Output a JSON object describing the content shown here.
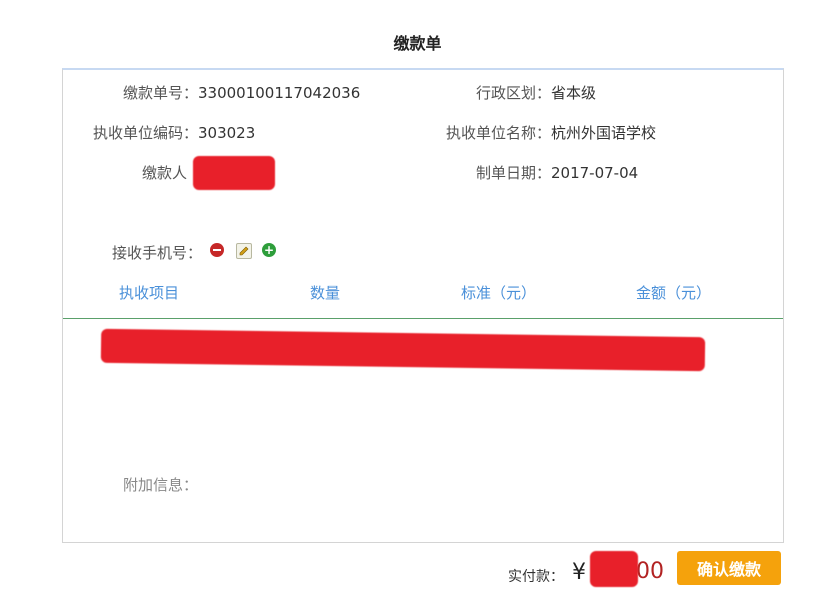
{
  "page_title": "缴款单",
  "fields": {
    "payment_no_label": "缴款单号：",
    "payment_no_value": "33000100117042036",
    "region_label": "行政区划：",
    "region_value": "省本级",
    "unit_code_label": "执收单位编码：",
    "unit_code_value": "303023",
    "unit_name_label": "执收单位名称：",
    "unit_name_value": "杭州外国语学校",
    "payer_label": "缴款人",
    "date_label": "制单日期：",
    "date_value": "2017-07-04",
    "phone_label": "接收手机号："
  },
  "table": {
    "headers": [
      "执收项目",
      "数量",
      "标准（元）",
      "金额（元）"
    ]
  },
  "extra_info_label": "附加信息：",
  "footer": {
    "paid_label": "实付款：",
    "currency": "¥",
    "amount_tail": "00",
    "confirm_button": "确认缴款"
  },
  "icons": [
    "remove-icon",
    "edit-icon",
    "add-icon"
  ],
  "colors": {
    "header_blue": "#4a90d9",
    "button_orange": "#f5a20c",
    "redaction_red": "#e8202a"
  }
}
